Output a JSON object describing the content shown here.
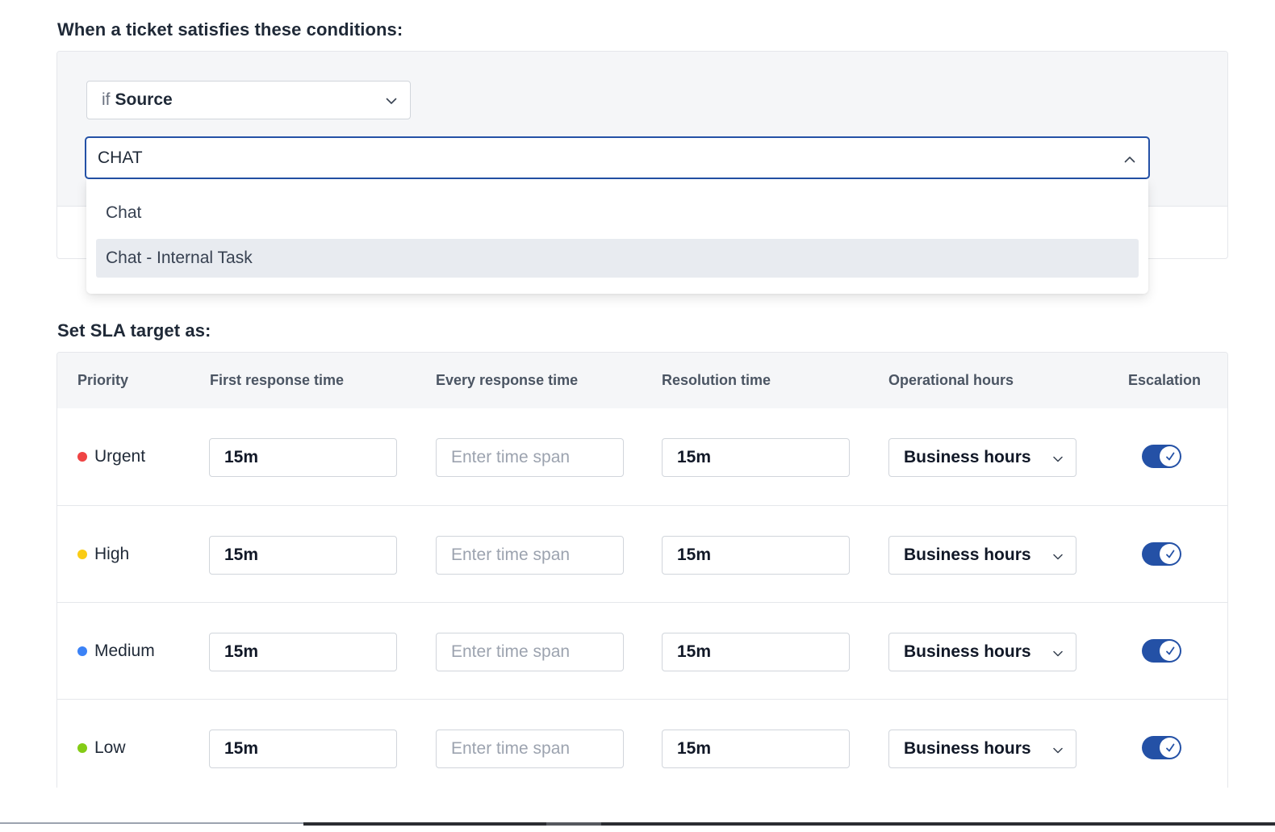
{
  "conditions": {
    "heading": "When a ticket satisfies these conditions:",
    "field_select": {
      "prefix": "if",
      "value": "Source"
    },
    "value_search": {
      "text": "CHAT",
      "state": "expanded"
    },
    "options": [
      {
        "label": "Chat",
        "highlighted": false
      },
      {
        "label": "Chat - Internal Task",
        "highlighted": true
      }
    ]
  },
  "sla": {
    "heading": "Set SLA target as:",
    "columns": {
      "priority": "Priority",
      "first_response": "First response time",
      "every_response": "Every response time",
      "resolution": "Resolution time",
      "operational_hours": "Operational hours",
      "escalation": "Escalation"
    },
    "rows": [
      {
        "priority": "Urgent",
        "dot_color": "#ef4444",
        "first_response": "15m",
        "every_response": "",
        "every_response_placeholder": "Enter time span",
        "resolution": "15m",
        "operational_hours": "Business hours",
        "escalation": true
      },
      {
        "priority": "High",
        "dot_color": "#facc15",
        "first_response": "15m",
        "every_response": "",
        "every_response_placeholder": "Enter time span",
        "resolution": "15m",
        "operational_hours": "Business hours",
        "escalation": true
      },
      {
        "priority": "Medium",
        "dot_color": "#3b82f6",
        "first_response": "15m",
        "every_response": "",
        "every_response_placeholder": "Enter time span",
        "resolution": "15m",
        "operational_hours": "Business hours",
        "escalation": true
      },
      {
        "priority": "Low",
        "dot_color": "#84cc16",
        "first_response": "15m",
        "every_response": "",
        "every_response_placeholder": "Enter time span",
        "resolution": "15m",
        "operational_hours": "Business hours",
        "escalation": true
      }
    ]
  },
  "colors": {
    "accent": "#2451a6",
    "panel_bg": "#f5f6f8",
    "border": "#e5e7eb",
    "highlight": "#e8ebf0"
  },
  "icons": {
    "select_chevron": "chevron-down-icon",
    "search_chevron": "chevron-up-icon",
    "toggle_check": "check-icon"
  }
}
